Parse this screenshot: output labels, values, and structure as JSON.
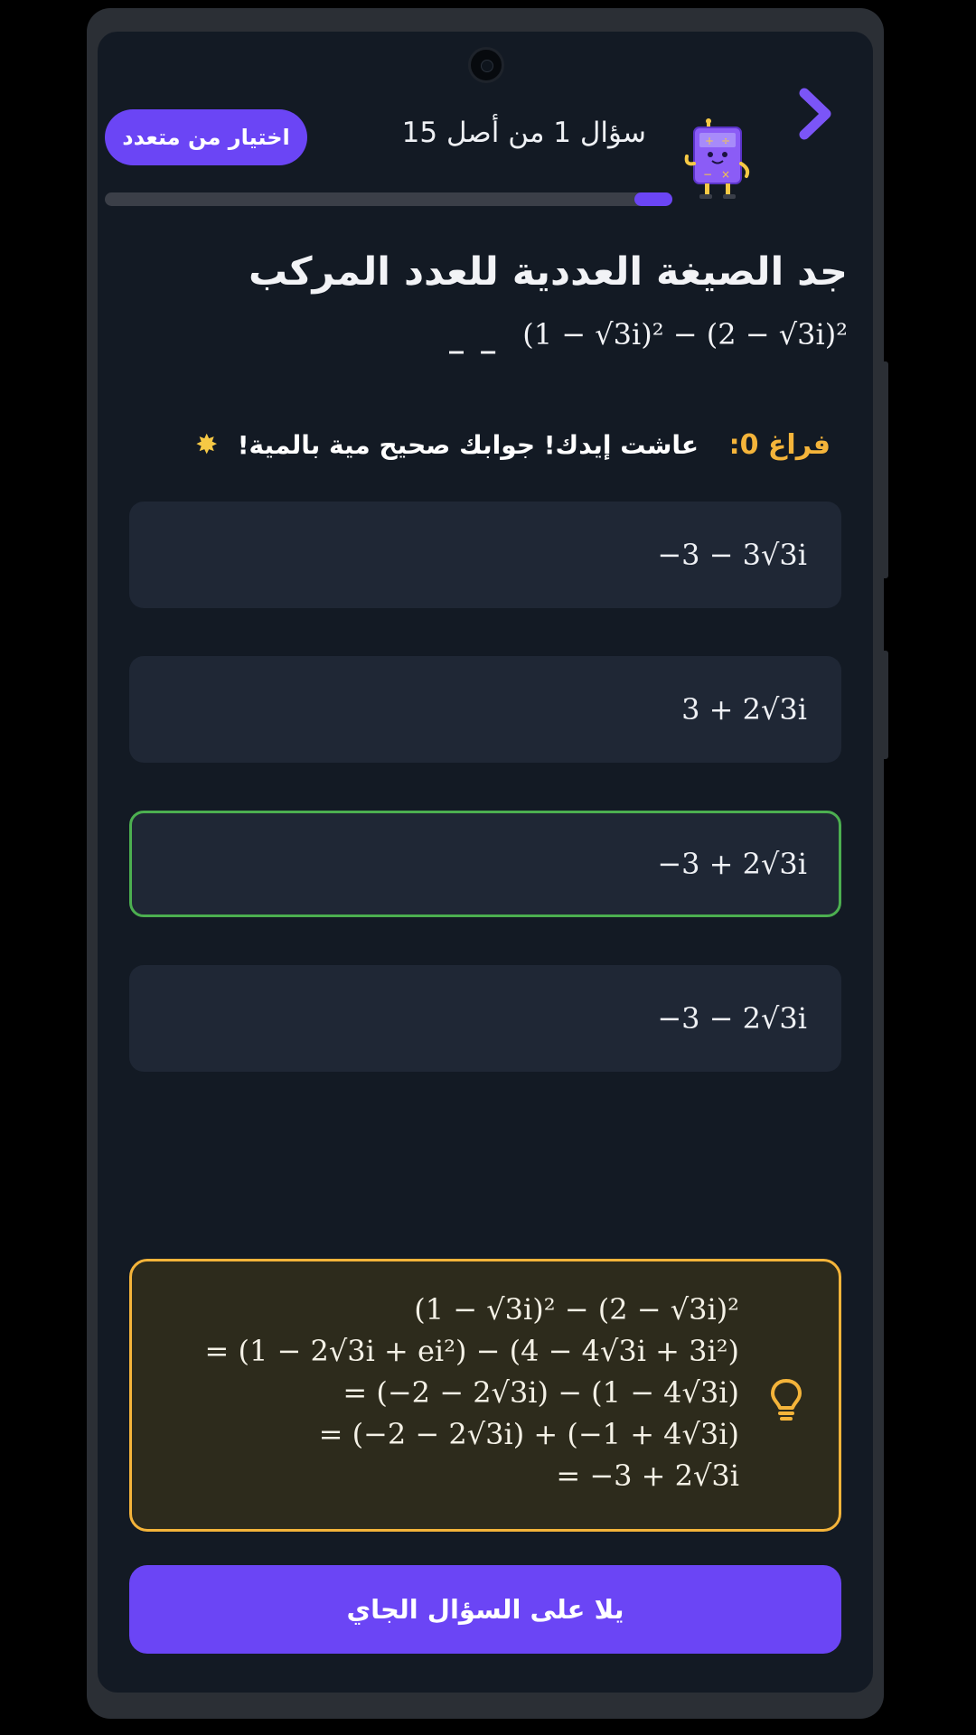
{
  "header": {
    "question_counter": "سؤال 1 من أصل 15",
    "question_type": "اختيار من متعدد",
    "progress": 0.067
  },
  "question": {
    "title": "جد الصيغة العددية للعدد المركب",
    "expression": "(1 − √3i)² − (2 − √3i)²",
    "blank": "_ _"
  },
  "feedback": {
    "tag": "فراغ 0:",
    "text": "عاشت إيدك! جوابك صحيح مية بالمية!",
    "icon": "star-icon"
  },
  "options": [
    {
      "value": "−3 − 3√3i",
      "state": "default"
    },
    {
      "value": "3 + 2√3i",
      "state": "default"
    },
    {
      "value": "−3 + 2√3i",
      "state": "correct"
    },
    {
      "value": "−3 − 2√3i",
      "state": "default"
    }
  ],
  "hint": {
    "icon": "lightbulb-icon",
    "lines": [
      "(1 − √3i)² − (2 − √3i)²",
      "= (1 − 2√3i + ei²) − (4 − 4√3i + 3i²)",
      "= (−2 − 2√3i) − (1 − 4√3i)",
      "= (−2 − 2√3i) + (−1 + 4√3i)",
      "= −3 + 2√3i"
    ]
  },
  "next_button": "يلا على السؤال الجاي",
  "colors": {
    "accent": "#6b45f5",
    "correct": "#4caf50",
    "hint_border": "#f4b43a",
    "background": "#131a24"
  }
}
